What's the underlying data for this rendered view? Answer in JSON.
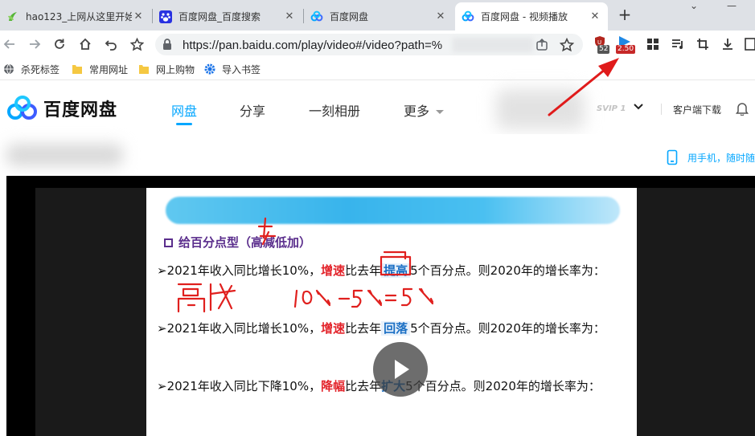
{
  "browser": {
    "tabs": [
      {
        "title": "hao123_上网从这里开始",
        "favicon": "hao123-icon"
      },
      {
        "title": "百度网盘_百度搜索",
        "favicon": "baidu-paw-icon"
      },
      {
        "title": "百度网盘",
        "favicon": "baidu-pan-icon"
      },
      {
        "title": "百度网盘 - 视频播放",
        "favicon": "baidu-pan-icon",
        "active": true
      }
    ],
    "url": "https://pan.baidu.com/play/video#/video?path=%",
    "extension_badges": {
      "shield": "52",
      "speed": "2.50"
    },
    "bookmarks": [
      {
        "label": "杀死标签",
        "icon": "globe-icon"
      },
      {
        "label": "常用网址",
        "icon": "folder-icon"
      },
      {
        "label": "网上购物",
        "icon": "folder-icon"
      },
      {
        "label": "导入书签",
        "icon": "gear-icon"
      }
    ]
  },
  "pan": {
    "logo_text": "百度网盘",
    "nav": [
      {
        "label": "网盘",
        "active": true
      },
      {
        "label": "分享"
      },
      {
        "label": "一刻相册"
      },
      {
        "label": "更多"
      }
    ],
    "svip": "SVIP 1",
    "client_download": "客户端下载",
    "mobile_tip": "用手机，随时随"
  },
  "slide": {
    "title": "给百分点型（高减低加）",
    "lines": [
      {
        "prefix": "➢2021年收入同比增长10%，",
        "keyword": "增速",
        "mid": "比去年",
        "change": "提高",
        "suffix": "5个百分点。则2020年的增长率为："
      },
      {
        "prefix": "➢2021年收入同比增长10%，",
        "keyword": "增速",
        "mid": "比去年",
        "change": "回落",
        "suffix": "5个百分点。则2020年的增长率为："
      },
      {
        "prefix": "➢2021年收入同比下降10%，",
        "keyword": "降幅",
        "mid": "比去年",
        "change": "扩大",
        "suffix": "5个百分点。则2020年的增长率为："
      }
    ],
    "handwriting": [
      "高减",
      "10%-5%=5%"
    ]
  },
  "colors": {
    "accent": "#06a7ff",
    "slide_title": "#5a2d8c",
    "keyword_red": "#e3242b",
    "keyword_blue": "#1a6fc4",
    "ink_red": "#e0201e"
  }
}
